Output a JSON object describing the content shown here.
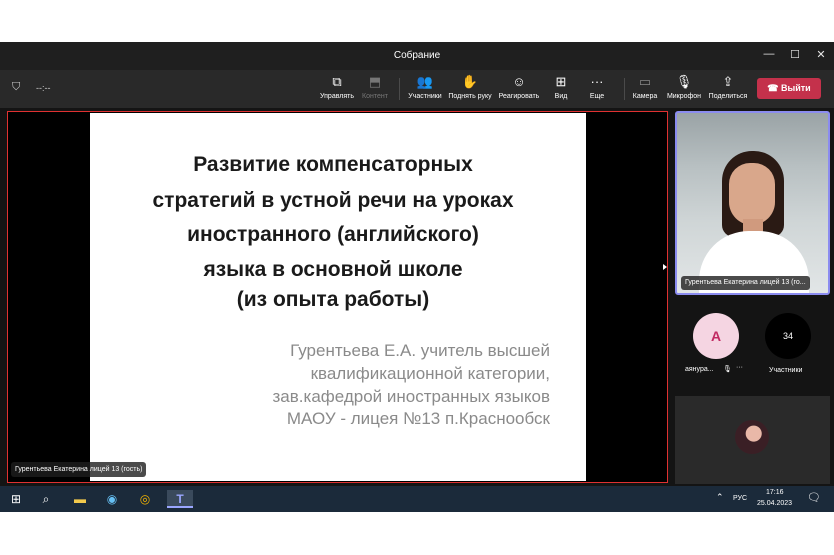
{
  "window": {
    "title": "Собрание",
    "minimize": "—",
    "maximize": "☐",
    "close": "✕"
  },
  "meeting": {
    "timer": "--:--"
  },
  "toolbar": {
    "items": [
      {
        "label": "Управлять",
        "icon": "manage-screen-icon",
        "glyph": "⧉"
      },
      {
        "label": "Контент",
        "icon": "content-icon",
        "glyph": "⬒"
      },
      {
        "label": "Участники",
        "icon": "participants-icon",
        "glyph": "👥"
      },
      {
        "label": "Поднять руку",
        "icon": "raise-hand-icon",
        "glyph": "✋"
      },
      {
        "label": "Реагировать",
        "icon": "react-icon",
        "glyph": "☺"
      },
      {
        "label": "Вид",
        "icon": "view-grid-icon",
        "glyph": "⊞"
      },
      {
        "label": "Еще",
        "icon": "more-icon",
        "glyph": "···"
      },
      {
        "label": "Камера",
        "icon": "camera-off-icon",
        "glyph": "▭"
      },
      {
        "label": "Микрофон",
        "icon": "mic-off-icon",
        "glyph": "🎙"
      },
      {
        "label": "Поделиться",
        "icon": "share-icon",
        "glyph": "⇪"
      }
    ],
    "leave_label": "Выйти",
    "leave_icon": "☎"
  },
  "slide": {
    "title_lines": [
      "Развитие компенсаторных",
      "стратегий в устной речи на уроках",
      "иностранного (английского)",
      "языка в основной школе",
      "(из опыта работы)"
    ],
    "author_lines": [
      "Гурентьева Е.А. учитель высшей",
      "квалификационной категории,",
      "зав.кафедрой иностранных языков",
      "МАОУ - лицея №13 п.Краснообск"
    ]
  },
  "presenter": {
    "name": "Гурентьева Екатерина лицей 13 (гость)"
  },
  "camera_tile": {
    "name": "Гурентьева Екатерина лицей 13 (го..."
  },
  "participants": [
    {
      "initial": "A",
      "name": "аянура...",
      "mic": "🎙",
      "more": "···"
    },
    {
      "initial": "34",
      "name": "Участники"
    }
  ],
  "taskbar": {
    "start": "⊞",
    "search": "⌕",
    "explorer": "▬",
    "steam": "◉",
    "chrome": "◎",
    "teams": "T",
    "tray_up": "⌃",
    "language": "РУС",
    "time": "17:16",
    "date": "25.04.2023",
    "notifications": "🗨"
  },
  "colors": {
    "leave_button": "#c4314b",
    "active_speaker_border": "#e03131",
    "camera_border": "#8b8cf0",
    "taskbar": "#1b2a3a"
  }
}
